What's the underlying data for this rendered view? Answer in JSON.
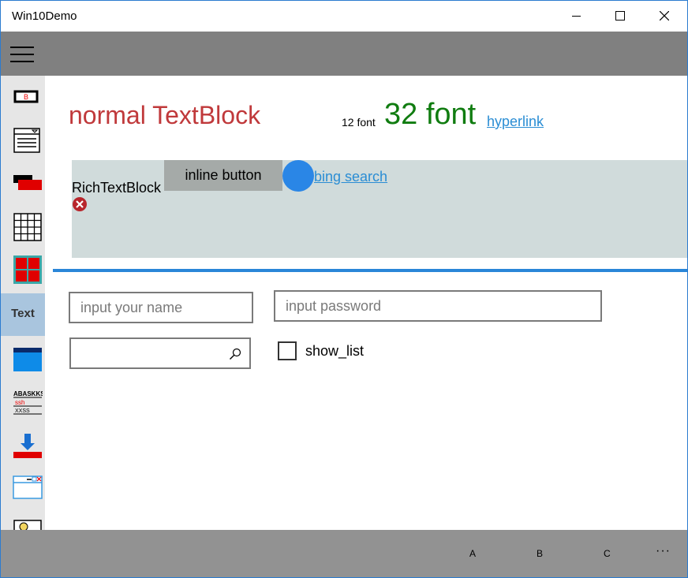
{
  "window": {
    "title": "Win10Demo"
  },
  "nav": {
    "items": [
      {
        "icon": "button-icon"
      },
      {
        "icon": "dropdown-list-icon"
      },
      {
        "icon": "layers-icon"
      },
      {
        "icon": "grid-icon"
      },
      {
        "icon": "tiles-icon"
      },
      {
        "icon": "text-icon",
        "label": "Text",
        "selected": true
      },
      {
        "icon": "window-icon"
      },
      {
        "icon": "text-lines-icon"
      },
      {
        "icon": "download-icon"
      },
      {
        "icon": "dialog-icon"
      },
      {
        "icon": "image-icon"
      }
    ]
  },
  "content": {
    "normal_textblock": "normal TextBlock",
    "small_text": "12 font",
    "big_text": "32 font",
    "hyperlink": "hyperlink",
    "rich": {
      "label": "RichTextBlock",
      "inline_button": "inline button",
      "link": "bing search"
    },
    "inputs": {
      "name_placeholder": "input your name",
      "password_placeholder": "input password",
      "search_value": ""
    },
    "checkbox": {
      "label": "show_list",
      "checked": false
    }
  },
  "commandbar": {
    "buttons": [
      "A",
      "B",
      "C"
    ],
    "more": "···"
  },
  "colors": {
    "accent": "#2a86d8",
    "normal_text": "#c0393b",
    "big_text": "#107c10",
    "link": "#2a8dd4",
    "topbar": "#808080",
    "commandbar": "#929292"
  }
}
